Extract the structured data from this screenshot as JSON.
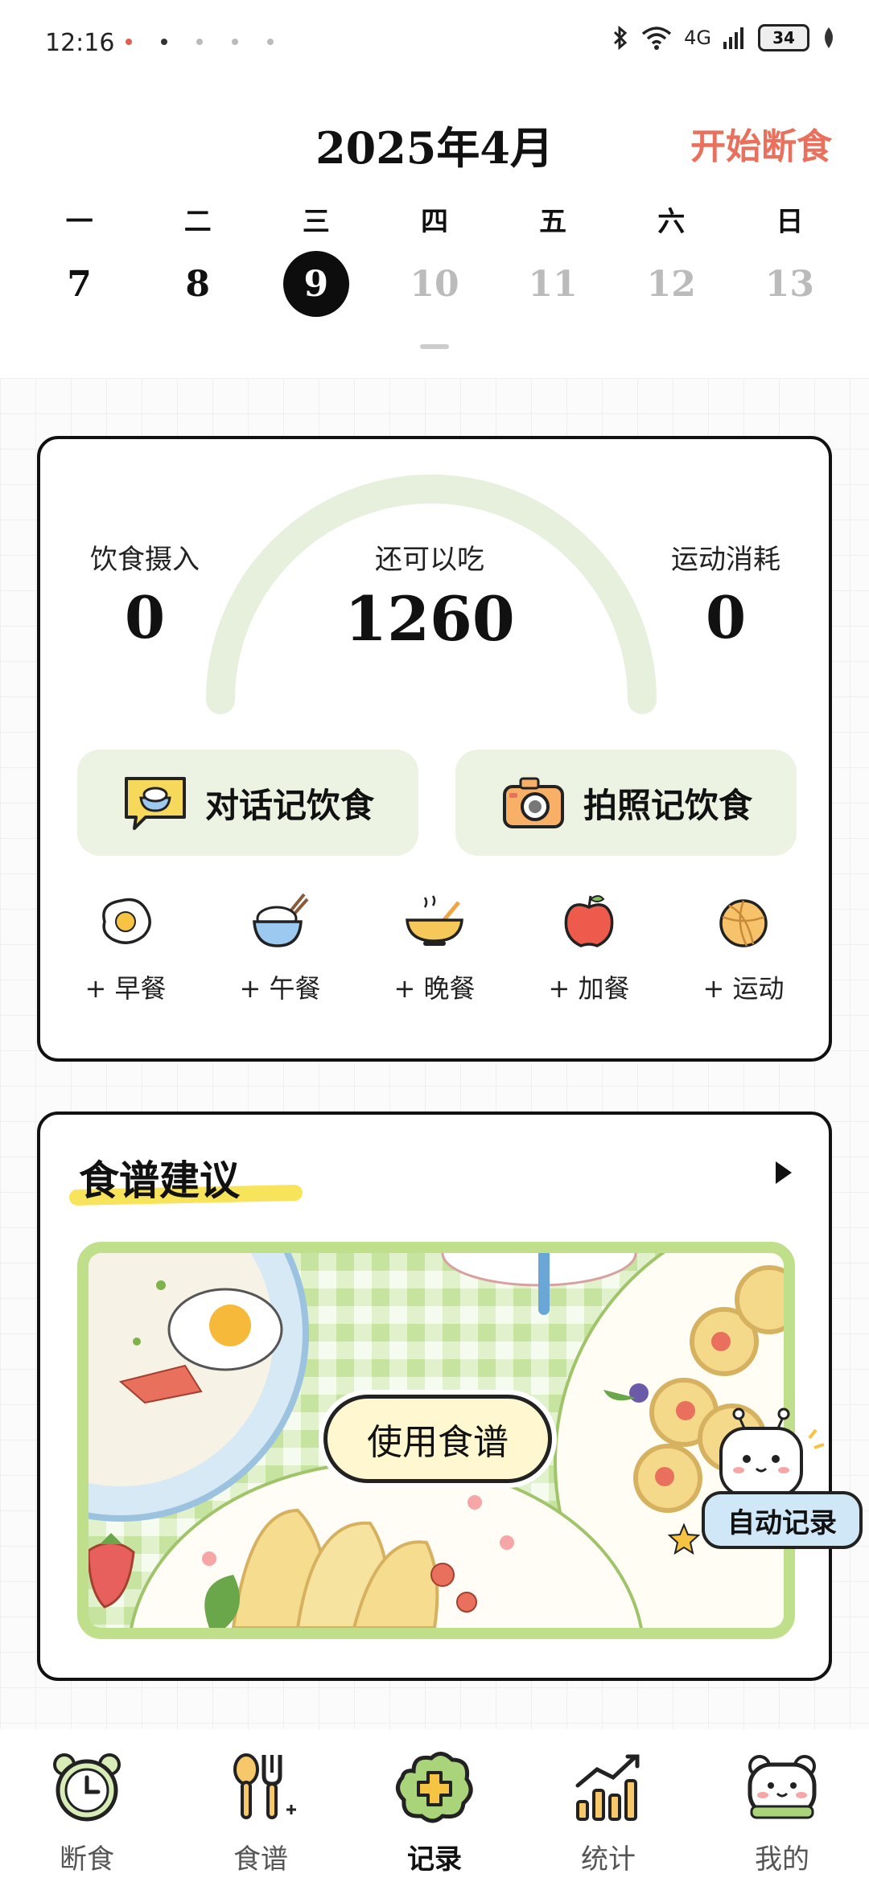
{
  "status_bar": {
    "time": "12:16",
    "network": "4G",
    "battery": "34"
  },
  "header": {
    "month_title": "2025年4月",
    "start_fast_label": "开始断食"
  },
  "calendar": {
    "weekdays": [
      "一",
      "二",
      "三",
      "四",
      "五",
      "六",
      "日"
    ],
    "dates": [
      {
        "day": "7",
        "state": "past"
      },
      {
        "day": "8",
        "state": "past"
      },
      {
        "day": "9",
        "state": "selected"
      },
      {
        "day": "10",
        "state": "future"
      },
      {
        "day": "11",
        "state": "future"
      },
      {
        "day": "12",
        "state": "future"
      },
      {
        "day": "13",
        "state": "future"
      }
    ]
  },
  "summary": {
    "intake_label": "饮食摄入",
    "intake_value": "0",
    "remaining_label": "还可以吃",
    "remaining_value": "1260",
    "burn_label": "运动消耗",
    "burn_value": "0",
    "chat_record_label": "对话记饮食",
    "photo_record_label": "拍照记饮食",
    "meals": [
      {
        "label": "+ 早餐",
        "icon": "fried-egg-icon"
      },
      {
        "label": "+ 午餐",
        "icon": "rice-bowl-icon"
      },
      {
        "label": "+ 晚餐",
        "icon": "soup-bowl-icon"
      },
      {
        "label": "+ 加餐",
        "icon": "apple-icon"
      },
      {
        "label": "+ 运动",
        "icon": "basketball-icon"
      }
    ]
  },
  "recipe": {
    "title": "食谱建议",
    "use_recipe_label": "使用食谱",
    "auto_record_label": "自动记录"
  },
  "bottom_nav": [
    {
      "label": "断食",
      "icon": "alarm-clock-icon",
      "active": false
    },
    {
      "label": "食谱",
      "icon": "spoon-fork-icon",
      "active": false
    },
    {
      "label": "记录",
      "icon": "plus-cloud-icon",
      "active": true
    },
    {
      "label": "统计",
      "icon": "bar-chart-icon",
      "active": false
    },
    {
      "label": "我的",
      "icon": "bear-face-icon",
      "active": false
    }
  ],
  "colors": {
    "accent_red": "#e8705d",
    "soft_green": "#ecf3e2",
    "gauge_green": "#e6f0dc",
    "highlight_yellow": "#f7e45a",
    "frame_green": "#bfdf8a"
  }
}
